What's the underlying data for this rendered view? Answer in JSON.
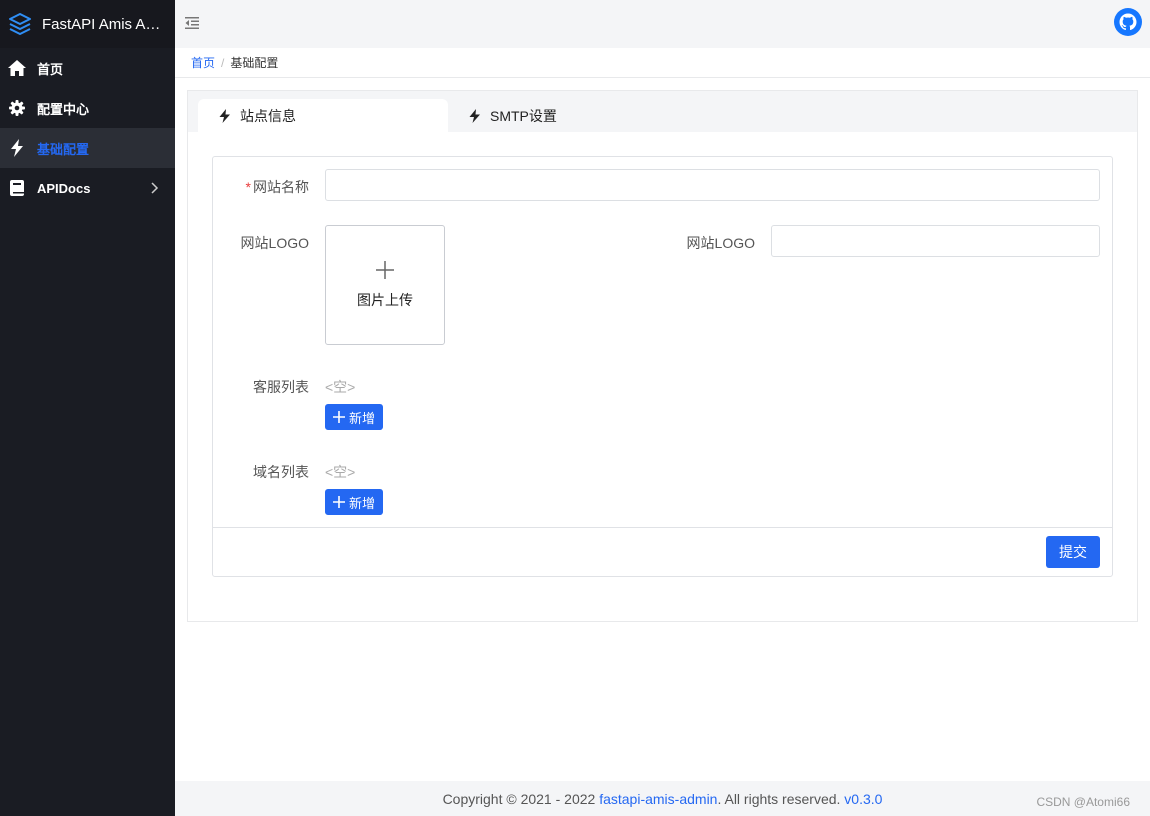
{
  "app": {
    "title": "FastAPI Amis Admin"
  },
  "sidebar": {
    "items": [
      {
        "label": "首页",
        "icon": "home-icon",
        "active": false
      },
      {
        "label": "配置中心",
        "icon": "gear-icon",
        "active": false
      },
      {
        "label": "基础配置",
        "icon": "bolt-icon",
        "active": true
      },
      {
        "label": "APIDocs",
        "icon": "book-icon",
        "active": false,
        "has_children": true
      }
    ]
  },
  "breadcrumb": {
    "home": "首页",
    "separator": "/",
    "current": "基础配置"
  },
  "tabs": [
    {
      "label": "站点信息",
      "icon": "bolt-icon",
      "active": true
    },
    {
      "label": "SMTP设置",
      "icon": "bolt-icon",
      "active": false
    }
  ],
  "form": {
    "site_name_label": "网站名称",
    "site_name_value": "",
    "site_logo_label": "网站LOGO",
    "upload_label": "图片上传",
    "site_logo_url_label": "网站LOGO",
    "site_logo_url_value": "",
    "service_list_label": "客服列表",
    "service_list_empty": "<空>",
    "domain_list_label": "域名列表",
    "domain_list_empty": "<空>",
    "add_label": "新增",
    "submit_label": "提交"
  },
  "footer": {
    "prefix": "Copyright © 2021 - 2022 ",
    "project": "fastapi-amis-admin",
    "suffix": ". All rights reserved. ",
    "version": "v0.3.0"
  },
  "watermark": "CSDN @Atomi66",
  "colors": {
    "accent": "#2468f2",
    "sidebar_bg": "#1a1c23",
    "required": "#e93b3b"
  }
}
